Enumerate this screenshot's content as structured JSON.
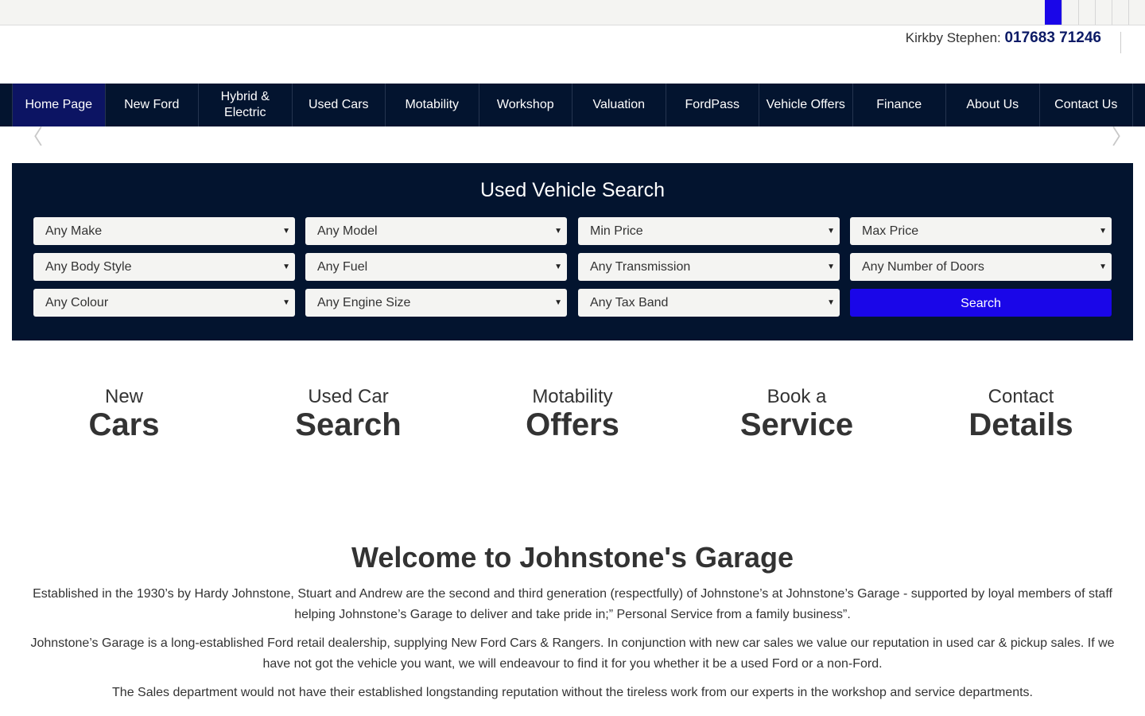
{
  "topbar": {
    "icons": [
      "social-icon-active",
      "social-icon",
      "social-icon",
      "social-icon",
      "social-icon",
      "social-icon"
    ]
  },
  "header": {
    "location_label": "Kirkby Stephen:",
    "phone_number": "017683 71246"
  },
  "nav": {
    "items": [
      {
        "label": "Home Page"
      },
      {
        "label": "New Ford"
      },
      {
        "label": "Hybrid & Electric"
      },
      {
        "label": "Used Cars"
      },
      {
        "label": "Motability"
      },
      {
        "label": "Workshop"
      },
      {
        "label": "Valuation"
      },
      {
        "label": "FordPass"
      },
      {
        "label": "Vehicle Offers"
      },
      {
        "label": "Finance"
      },
      {
        "label": "About Us"
      },
      {
        "label": "Contact Us"
      }
    ]
  },
  "carousel": {
    "prev_glyph": "〈",
    "next_glyph": "〉"
  },
  "search": {
    "title": "Used Vehicle Search",
    "make": "Any Make",
    "model": "Any Model",
    "min_price": "Min Price",
    "max_price": "Max Price",
    "body_style": "Any Body Style",
    "fuel": "Any Fuel",
    "transmission": "Any Transmission",
    "doors": "Any Number of Doors",
    "colour": "Any Colour",
    "engine_size": "Any Engine Size",
    "tax_band": "Any Tax Band",
    "button_label": "Search",
    "caret": "▼"
  },
  "tiles": [
    {
      "small": "New",
      "large": "Cars"
    },
    {
      "small": "Used Car",
      "large": "Search"
    },
    {
      "small": "Motability",
      "large": "Offers"
    },
    {
      "small": "Book a",
      "large": "Service"
    },
    {
      "small": "Contact",
      "large": "Details"
    }
  ],
  "welcome": {
    "title": "Welcome to Johnstone's Garage",
    "paragraphs": [
      "Established in the 1930’s by Hardy Johnstone, Stuart and Andrew are the second and third generation (respectfully) of Johnstone’s at Johnstone’s Garage - supported by loyal members of staff helping Johnstone’s Garage to deliver and take pride in;” Personal Service from a family business”.",
      "Johnstone’s Garage is a long-established Ford retail dealership, supplying New Ford Cars & Rangers.  In conjunction with new car sales we value our reputation in used car & pickup sales.  If we have not got the vehicle you want, we will endeavour to find it for you whether it be a used Ford or a non-Ford.",
      "The Sales department would not have their established longstanding reputation without the tireless work from our experts in the workshop and service departments."
    ]
  },
  "colors": {
    "navy": "#03142f",
    "accent_blue": "#1a06e8",
    "phone_blue": "#0b1a66"
  }
}
